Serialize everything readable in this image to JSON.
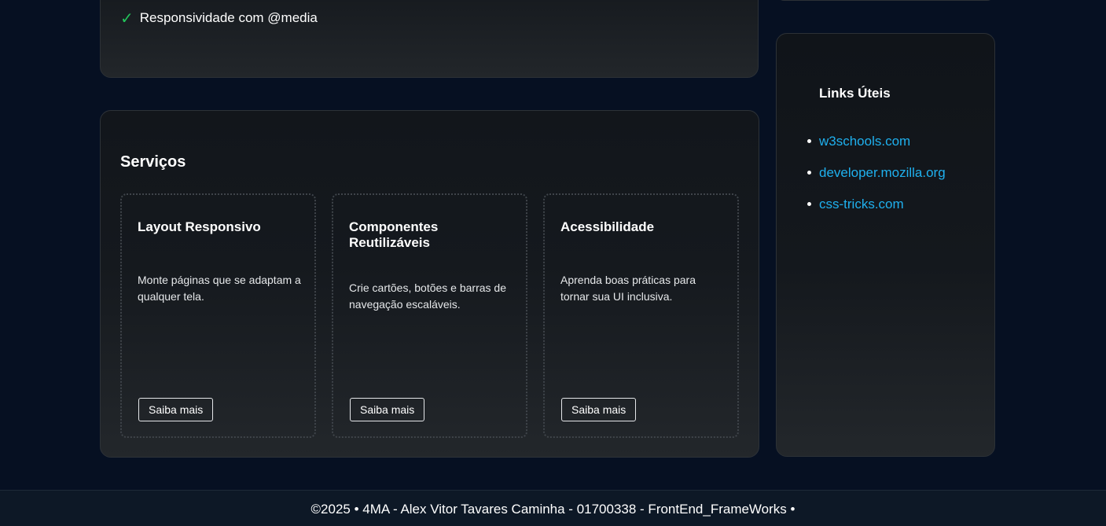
{
  "top_card": {
    "feature_check": "✓",
    "feature_text": "Responsividade com @media"
  },
  "services": {
    "title": "Serviços",
    "items": [
      {
        "title": "Layout Responsivo",
        "description": "Monte páginas que se adaptam a qualquer tela.",
        "button": "Saiba mais"
      },
      {
        "title": "Componentes Reutilizáveis",
        "description": "Crie cartões, botões e barras de navegação escaláveis.",
        "button": "Saiba mais"
      },
      {
        "title": "Acessibilidade",
        "description": "Aprenda boas práticas para tornar sua UI inclusiva.",
        "button": "Saiba mais"
      }
    ]
  },
  "sidebar": {
    "title": "Links Úteis",
    "links": [
      "w3schools.com",
      "developer.mozilla.org",
      "css-tricks.com"
    ]
  },
  "footer": {
    "text": "©2025 • 4MA - Alex Vitor Tavares Caminha - 01700338 - FrontEnd_FrameWorks •"
  },
  "colors": {
    "background": "#061022",
    "accent_link": "#1fb0ee",
    "check": "#22c35a"
  }
}
